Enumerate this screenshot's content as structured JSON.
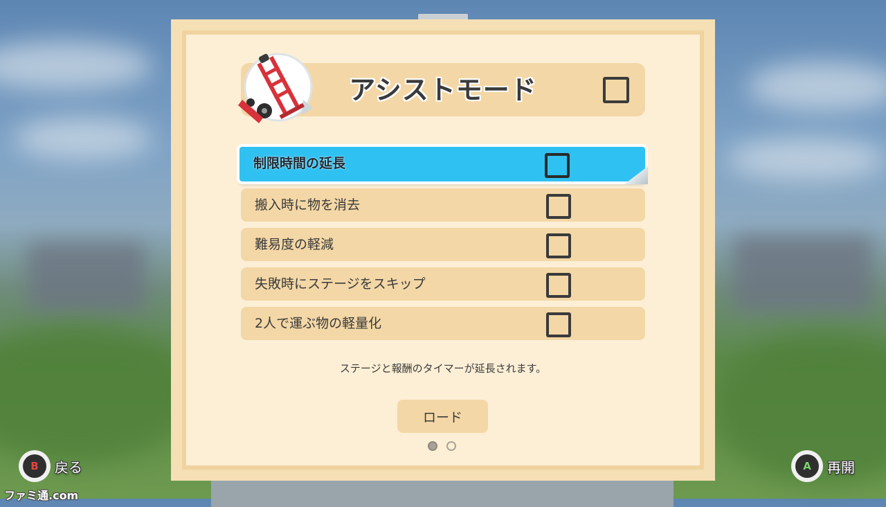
{
  "title": {
    "text": "アシストモード",
    "checked": false
  },
  "options": [
    {
      "label": "制限時間の延長",
      "checked": false,
      "selected": true
    },
    {
      "label": "搬入時に物を消去",
      "checked": false,
      "selected": false
    },
    {
      "label": "難易度の軽減",
      "checked": false,
      "selected": false
    },
    {
      "label": "失敗時にステージをスキップ",
      "checked": false,
      "selected": false
    },
    {
      "label": "2人で運ぶ物の軽量化",
      "checked": false,
      "selected": false
    }
  ],
  "description": "ステージと報酬のタイマーが延長されます。",
  "load_button_label": "ロード",
  "pagination": {
    "current": 1,
    "total": 2
  },
  "controls": {
    "back": {
      "button": "B",
      "label": "戻る"
    },
    "resume": {
      "button": "A",
      "label": "再開"
    }
  },
  "watermark": "ファミ通.com",
  "colors": {
    "selected_row": "#2fc1f2",
    "row": "#f3d7a6",
    "board": "#fcefd6",
    "text": "#3a3a3a"
  }
}
